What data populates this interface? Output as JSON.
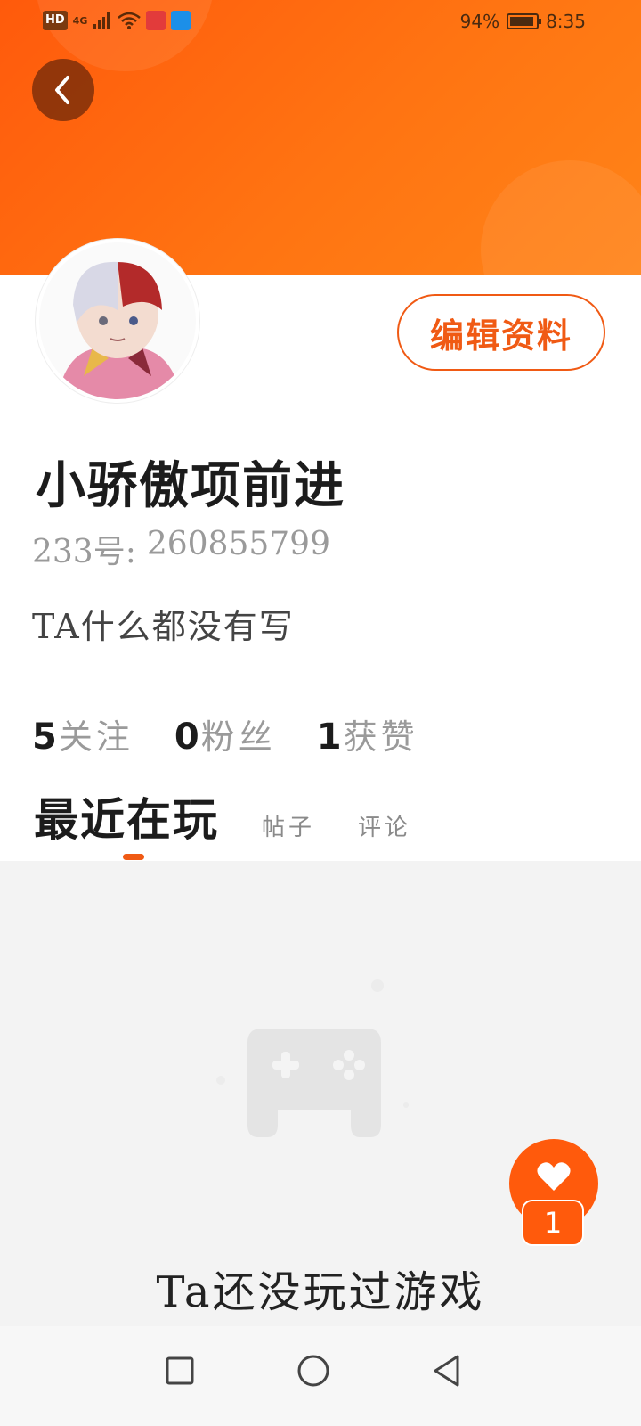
{
  "status_bar": {
    "hd": "HD",
    "network": "4G",
    "battery": "94%",
    "time": "8:35"
  },
  "profile": {
    "edit_label": "编辑资料",
    "username": "小骄傲项前进",
    "uid_label": "233号:",
    "uid": "260855799",
    "bio": "TA什么都没有写"
  },
  "stats": [
    {
      "num": "5",
      "label": "关注"
    },
    {
      "num": "0",
      "label": "粉丝"
    },
    {
      "num": "1",
      "label": "获赞"
    }
  ],
  "tabs": [
    {
      "label": "最近在玩",
      "active": true
    },
    {
      "label": "帖子",
      "active": false
    },
    {
      "label": "评论",
      "active": false
    }
  ],
  "empty_text": "Ta还没玩过游戏",
  "like_count": "1",
  "colors": {
    "accent": "#f05a14",
    "header": "#ff6a10"
  }
}
